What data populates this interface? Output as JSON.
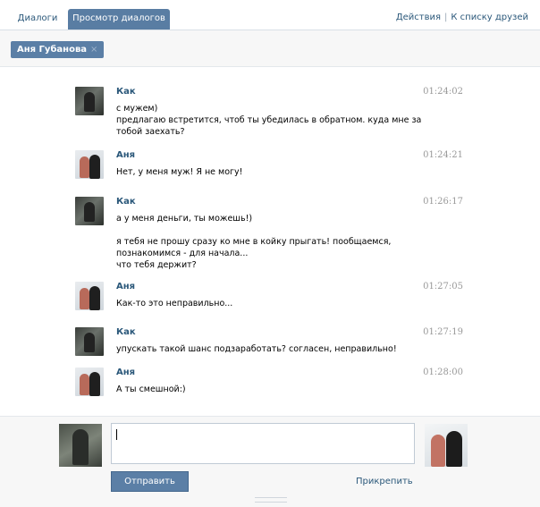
{
  "tabs": [
    {
      "label": "Диалоги",
      "active": false
    },
    {
      "label": "Просмотр диалогов",
      "active": true
    }
  ],
  "header_links": {
    "actions": "Действия",
    "separator": "|",
    "friends": "К списку друзей"
  },
  "filter": {
    "chip_label": "Аня Губанова",
    "close_icon": "×"
  },
  "messages": [
    {
      "author": "Как",
      "time": "01:24:02",
      "text": "с мужем)\nпредлагаю встретится, чтоб ты убедилась в обратном. куда мне за\nтобой заехать?"
    },
    {
      "author": "Аня",
      "time": "01:24:21",
      "text": "Нет, у меня муж! Я не могу!"
    },
    {
      "author": "Как",
      "time": "01:26:17",
      "text": "а у меня деньги, ты можешь!)\n\nя тебя не прошу сразу ко мне в койку прыгать! пообщаемся,\nпознакомимся - для начала...\nчто тебя держит?"
    },
    {
      "author": "Аня",
      "time": "01:27:05",
      "text": "Как-то это неправильно..."
    },
    {
      "author": "Как",
      "time": "01:27:19",
      "text": "упускать такой шанс подзаработать? согласен, неправильно!"
    },
    {
      "author": "Аня",
      "time": "01:28:00",
      "text": "А ты смешной:)"
    }
  ],
  "composer": {
    "send_label": "Отправить",
    "attach_label": "Прикрепить"
  }
}
